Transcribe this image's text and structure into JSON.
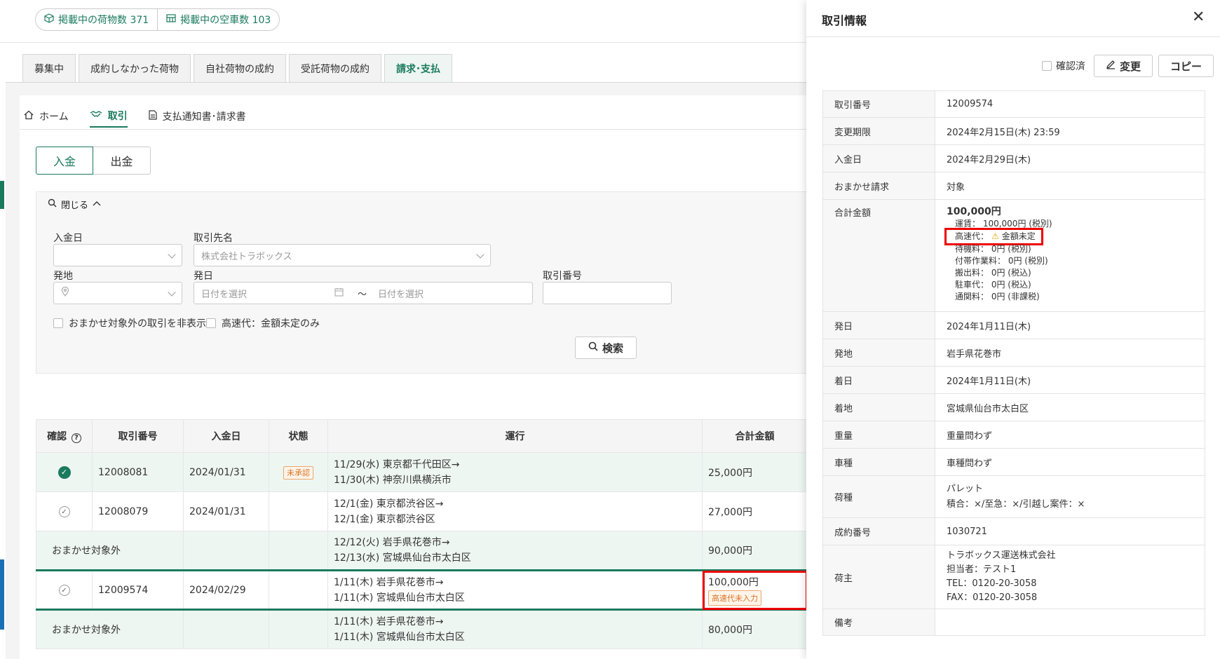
{
  "stats": {
    "cargo_label": "掲載中の荷物数 371",
    "truck_label": "掲載中の空車数 103"
  },
  "main_tabs": [
    "募集中",
    "成約しなかった荷物",
    "自社荷物の成約",
    "受託荷物の成約",
    "請求･支払"
  ],
  "subnav": {
    "home": "ホーム",
    "deals": "取引",
    "notice": "支払通知書･請求書"
  },
  "toggle": {
    "income": "入金",
    "expense": "出金"
  },
  "search": {
    "collapse_label": "閉じる",
    "payment_date_label": "入金日",
    "partner_label": "取引先名",
    "partner_placeholder": "株式会社トラボックス",
    "origin_label": "発地",
    "depart_label": "発日",
    "date_placeholder_from": "日付を選択",
    "date_sep": "～",
    "date_placeholder_to": "日付を選択",
    "deal_no_label": "取引番号",
    "cb_hide_label": "おまかせ対象外の取引を非表示",
    "cb_toll_label": "高速代：金額未定のみ",
    "search_button": "検索"
  },
  "table": {
    "headers": [
      "確認",
      "取引番号",
      "入金日",
      "状態",
      "運行",
      "合計金額"
    ],
    "rows": [
      {
        "check": "on",
        "no": "12008081",
        "date": "2024/01/31",
        "status": "未承認",
        "route1": "11/29(水) 東京都千代田区→",
        "route2": "11/30(木) 神奈川県横浜市",
        "amount": "25,000円",
        "badge": ""
      },
      {
        "check": "off",
        "no": "12008079",
        "date": "2024/01/31",
        "status": "",
        "route1": "12/1(金) 東京都渋谷区→",
        "route2": "12/1(金) 東京都渋谷区",
        "amount": "27,000円",
        "badge": ""
      },
      {
        "check": "none",
        "no": "おまかせ対象外",
        "date": "",
        "status": "",
        "route1": "12/12(火) 岩手県花巻市→",
        "route2": "12/13(水) 宮城県仙台市太白区",
        "amount": "90,000円",
        "badge": ""
      },
      {
        "check": "off",
        "no": "12009574",
        "date": "2024/02/29",
        "status": "",
        "route1": "1/11(木) 岩手県花巻市→",
        "route2": "1/11(木) 宮城県仙台市太白区",
        "amount": "100,000円",
        "badge": "高速代未入力"
      },
      {
        "check": "none",
        "no": "おまかせ対象外",
        "date": "",
        "status": "",
        "route1": "1/11(木) 岩手県花巻市→",
        "route2": "1/11(木) 宮城県仙台市太白区",
        "amount": "80,000円",
        "badge": ""
      }
    ]
  },
  "drawer": {
    "title": "取引情報",
    "confirmed_label": "確認済",
    "edit_label": "変更",
    "copy_label": "コピー",
    "fields": {
      "deal_no": {
        "k": "取引番号",
        "v": "12009574"
      },
      "deadline": {
        "k": "変更期限",
        "v": "2024年2月15日(木) 23:59"
      },
      "pay_date": {
        "k": "入金日",
        "v": "2024年2月29日(木)"
      },
      "omakase": {
        "k": "おまかせ請求",
        "v": "対象"
      },
      "total": {
        "k": "合計金額",
        "v": "100,000円"
      },
      "fare": "運賃： 100,000円 (税別)",
      "toll_key": "高速代：",
      "toll_val": "金額未定",
      "wait": "待機料： 0円 (税別)",
      "extra": "付帯作業料： 0円 (税別)",
      "export": "搬出料： 0円 (税込)",
      "parking": "駐車代： 0円 (税込)",
      "customs": "通関料： 0円 (非課税)",
      "depart": {
        "k": "発日",
        "v": "2024年1月11日(木)"
      },
      "origin": {
        "k": "発地",
        "v": "岩手県花巻市"
      },
      "arrive": {
        "k": "着日",
        "v": "2024年1月11日(木)"
      },
      "dest": {
        "k": "着地",
        "v": "宮城県仙台市太白区"
      },
      "weight": {
        "k": "重量",
        "v": "重量問わず"
      },
      "vehicle": {
        "k": "車種",
        "v": "車種問わず"
      },
      "cargo": {
        "k": "荷種",
        "v1": "パレット",
        "v2": "積合：×/至急：×/引越し案件：×"
      },
      "contract": {
        "k": "成約番号",
        "v": "1030721"
      },
      "shipper": {
        "k": "荷主",
        "v1": "トラボックス運送株式会社",
        "v2": "担当者：テスト1",
        "v3": "TEL：0120-20-3058",
        "v4": "FAX：0120-20-3058"
      },
      "note": {
        "k": "備考",
        "v": ""
      }
    }
  }
}
